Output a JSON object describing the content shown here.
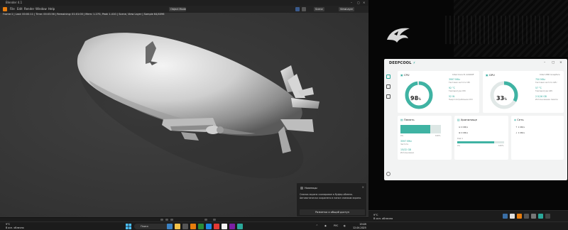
{
  "blender": {
    "window_title": "Blender 4.1",
    "menu": [
      "File",
      "Edit",
      "Render",
      "Window",
      "Help",
      "Layout"
    ],
    "mode": "Object Mode",
    "scene": "Scene",
    "view_layer": "ViewLayer",
    "stats": "Frame:1 | Last: 00:00.11 | Time: 00:03.56 | Remaining: 01:01:00 | Mem: 1.27G, Peak 1.41G | Scene, View Layer | Sample 64/4096"
  },
  "notification": {
    "app": "Ножницы",
    "text": "Снимок экрана скопирован в буфер обмена. Автоматически сохранено в папке снимков экрана.",
    "button": "Разметка и общий доступ",
    "close": "×"
  },
  "deepcool": {
    "brand_a": "DEEP",
    "brand_b": "COOL",
    "cpu": {
      "title": "CPU",
      "model": "Intel Core i5-12400F",
      "load": "98",
      "unit": "%",
      "freq": "3997 MHz",
      "freq_label": "Тактовая частота CPU",
      "temp": "92 °C",
      "temp_label": "Температура CPU",
      "power": "52 W",
      "power_label": "Энергопотребление CPU",
      "load_value": 98
    },
    "gpu": {
      "title": "GPU",
      "model": "Intel UHD Graphics",
      "load": "33",
      "unit": "%",
      "freq": "750 MHz",
      "freq_label": "Тактовая частота GPU",
      "temp": "57 °C",
      "temp_label": "Температура GPU",
      "mem": "2.5/16 GB",
      "mem_label": "Использование памяти",
      "load_value": 33
    },
    "memory": {
      "title": "Память",
      "used_pct": 74,
      "range_min": "0%",
      "range_max": "100%",
      "speed": "3597 MHz",
      "speed_label": "Частота",
      "used": "15/32 GB",
      "used_label": "Использовано"
    },
    "storage": {
      "title": "Хранилище",
      "read": "0 KB/s",
      "write": "0 KB/s",
      "disk": "Disk 1",
      "disk_pct": 79,
      "range_min": "0%",
      "range_max": "100%"
    },
    "network": {
      "title": "Сеть",
      "up": "1 KB/s",
      "down": "1 KB/s"
    }
  },
  "taskbar": {
    "weather_temp": "9°C",
    "weather_text": "В осн. облачно",
    "search_placeholder": "Поиск",
    "lang": "РУС",
    "time": "19:09",
    "date": "12.04.2025"
  },
  "taskbar2": {
    "weather_temp": "9°C",
    "weather_text": "В осн. облачно"
  }
}
